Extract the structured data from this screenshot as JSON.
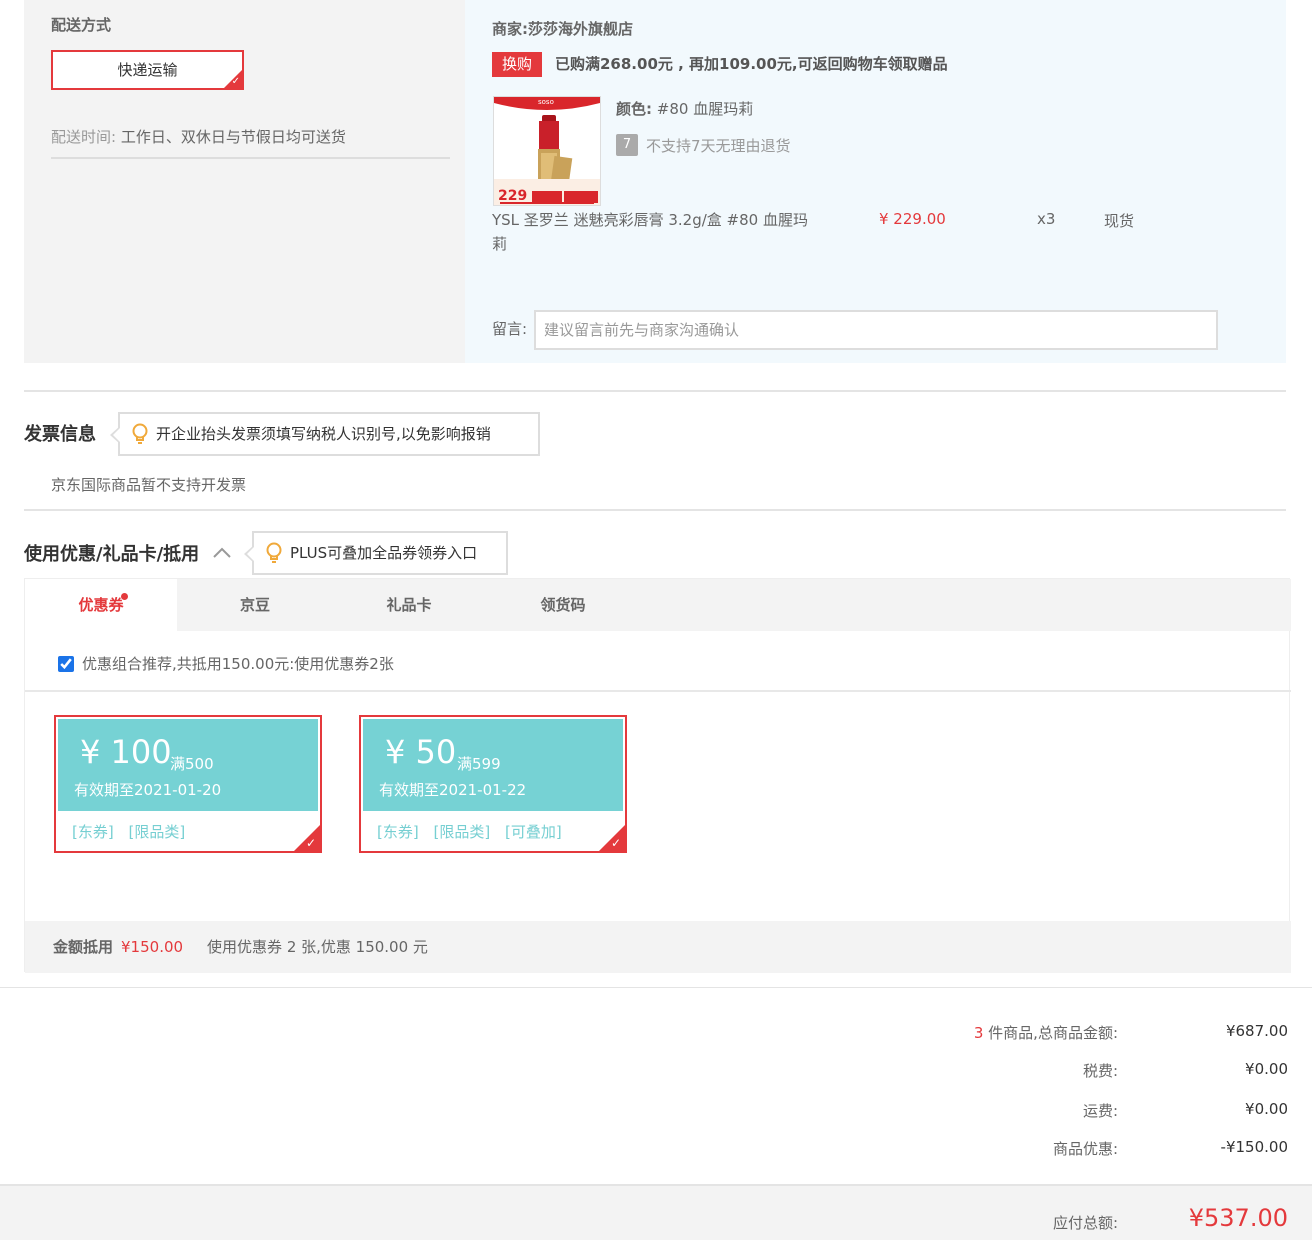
{
  "shipping": {
    "title": "配送方式",
    "method": "快递运输",
    "time_label": "配送时间:",
    "time_value": "工作日、双休日与节假日均可送货"
  },
  "merchant": {
    "label": "商家:莎莎海外旗舰店",
    "tag": "换购",
    "promo": "已购满268.00元 , 再加109.00元,可返回购物车领取赠品"
  },
  "product": {
    "img_badge": "soso",
    "img_price": "229",
    "color_label": "颜色:",
    "color_value": "#80 血腥玛莉",
    "return_icon": "7",
    "return_text": "不支持7天无理由退货",
    "name": "YSL 圣罗兰 迷魅亮彩唇膏 3.2g/盒 #80 血腥玛莉",
    "price": "¥ 229.00",
    "qty": "x3",
    "stock": "现货"
  },
  "message": {
    "label": "留言:",
    "placeholder": "建议留言前先与商家沟通确认"
  },
  "invoice": {
    "title": "发票信息",
    "tip": "开企业抬头发票须填写纳税人识别号,以免影响报销",
    "text": "京东国际商品暂不支持开发票"
  },
  "discount": {
    "title": "使用优惠/礼品卡/抵用",
    "tip": "PLUS可叠加全品券领券入口",
    "tabs": [
      {
        "label": "优惠券",
        "active": true
      },
      {
        "label": "京豆",
        "active": false
      },
      {
        "label": "礼品卡",
        "active": false
      },
      {
        "label": "领货码",
        "active": false
      }
    ],
    "recommend": "优惠组合推荐,共抵用150.00元:使用优惠券2张",
    "coupons": [
      {
        "amount": "¥ 100",
        "cond": "满500",
        "valid": "有效期至2021-01-20",
        "tags": [
          "[东券]",
          "[限品类]"
        ]
      },
      {
        "amount": "¥ 50",
        "cond": "满599",
        "valid": "有效期至2021-01-22",
        "tags": [
          "[东券]",
          "[限品类]",
          "[可叠加]"
        ]
      }
    ],
    "sum_label": "金额抵用",
    "sum_value": "¥150.00",
    "sum_text": "使用优惠券 2 张,优惠 150.00 元"
  },
  "totals": {
    "count": "3",
    "goods_label": " 件商品,总商品金额:",
    "goods_value": "¥687.00",
    "tax_label": "税费:",
    "tax_value": "¥0.00",
    "freight_label": "运费:",
    "freight_value": "¥0.00",
    "discount_label": "商品优惠:",
    "discount_value": "-¥150.00",
    "payable_label": "应付总额:",
    "payable_value": "¥537.00"
  },
  "colors": {
    "accent": "#e4393c",
    "coupon": "#76d2d4"
  }
}
